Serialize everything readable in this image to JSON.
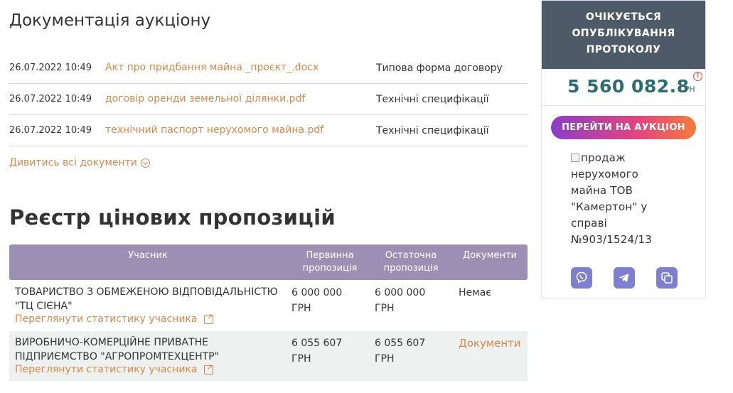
{
  "documents": {
    "title": "Документація аукціону",
    "rows": [
      {
        "date": "26.07.2022 10:49",
        "file": "Акт про придбання майна _проєкт_.docx",
        "type": "Типова форма договору"
      },
      {
        "date": "26.07.2022 10:49",
        "file": "договір оренди земельної ділянки.pdf",
        "type": "Технічні специфікації"
      },
      {
        "date": "26.07.2022 10:49",
        "file": "технічний паспорт нерухомого майна.pdf",
        "type": "Технічні специфікації"
      }
    ],
    "show_all": "Дивитись всі документи"
  },
  "registry": {
    "title": "Реєстр цінових пропозицій",
    "headers": {
      "participant": "Учасник",
      "first": "Первинна пропозиція",
      "last": "Остаточна пропозиція",
      "docs": "Документи"
    },
    "rows": [
      {
        "name": "ТОВАРИСТВО З ОБМЕЖЕНОЮ ВІДПОВІДАЛЬНІСТЮ \"ТЦ СІЄНА\"",
        "stats": "Переглянути статистику учасника",
        "first_value": "6 000 000",
        "first_cur": "ГРН",
        "last_value": "6 000 000",
        "last_cur": "ГРН",
        "docs": "Немає"
      },
      {
        "name": "ВИРОБНИЧО-КОМЕРЦІЙНЕ ПРИВАТНЕ ПІДПРИЄМСТВО \"АГРОПРОМТЕХЦЕНТР\"",
        "stats": "Переглянути статистику учасника",
        "first_value": "6 055 607",
        "first_cur": "ГРН",
        "last_value": "6 055 607",
        "last_cur": "ГРН",
        "docs": "Документи"
      }
    ]
  },
  "sidebar": {
    "status": "ОЧІКУЄТЬСЯ ОПУБЛІКУВАННЯ ПРОТОКОЛУ",
    "price": "5 560 082.8",
    "currency": "ГРН",
    "button": "ПЕРЕЙТИ НА АУКЦІОН",
    "image_alt": "продаж нерухомого майна ТОВ \"Камертон\" у справі №903/1524/13",
    "share_icons": [
      "viber-icon",
      "telegram-icon",
      "copy-icon"
    ]
  },
  "colors": {
    "accent": "#d4894b",
    "header_purple": "#9c8fb4",
    "status_bg": "#4e5a68",
    "price": "#2f6b73"
  }
}
